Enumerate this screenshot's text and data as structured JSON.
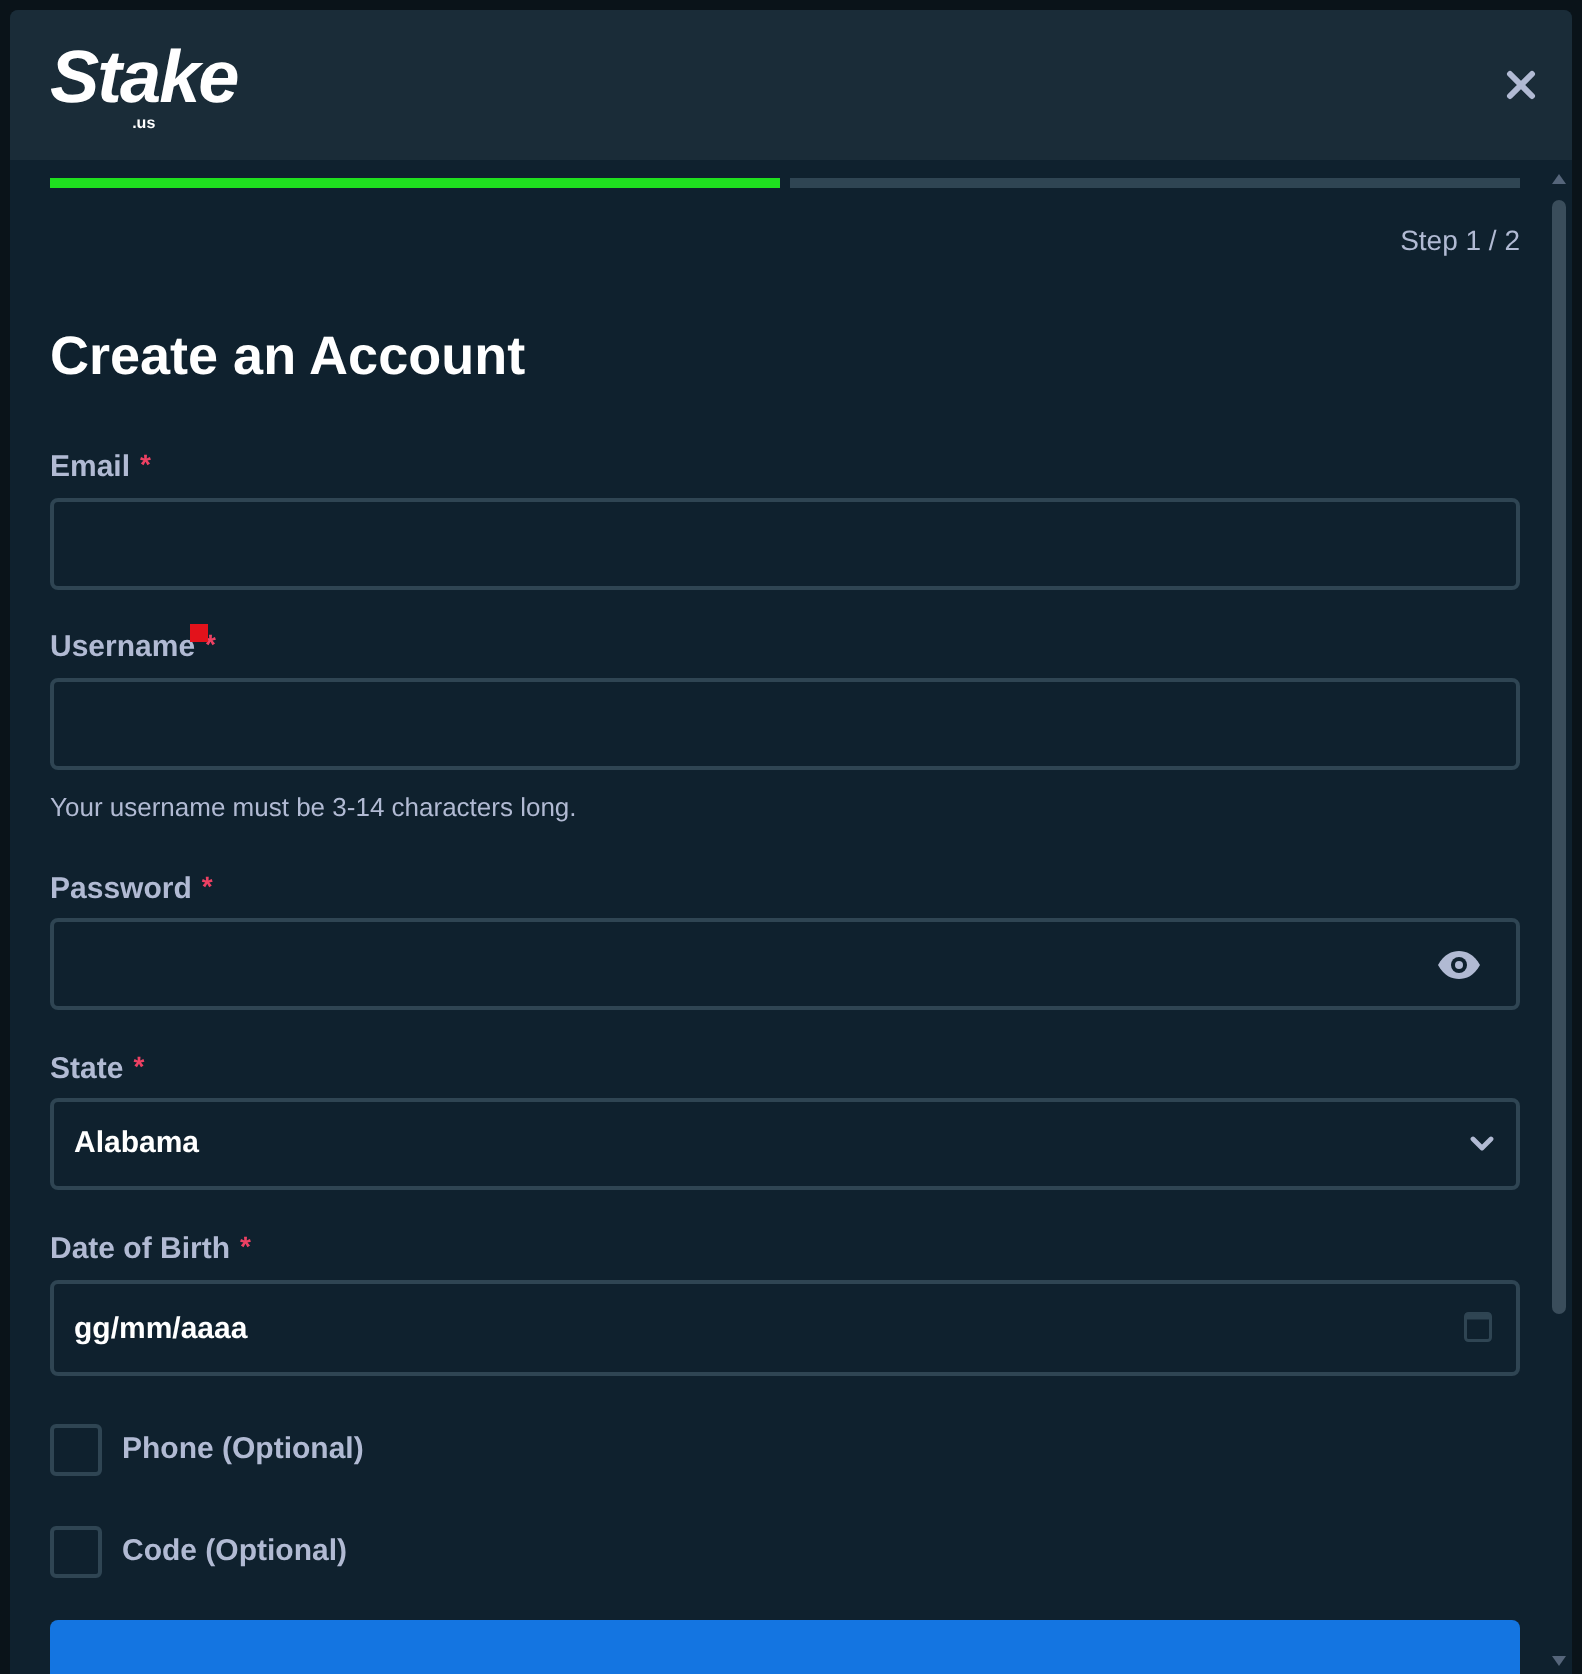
{
  "header": {
    "logo": {
      "wordmark": "Stake",
      "suffix": ".us"
    }
  },
  "progress": {
    "segments": [
      {
        "completed": true
      },
      {
        "completed": false
      }
    ],
    "step_label": "Step 1 / 2"
  },
  "title": "Create an Account",
  "fields": [
    {
      "kind": "email",
      "label": "Email",
      "required_mark": "*"
    },
    {
      "kind": "text",
      "label": "Username",
      "required_mark": "*",
      "marked": true,
      "hint": "Your username must be 3-14 characters long."
    },
    {
      "kind": "password",
      "label": "Password",
      "required_mark": "*"
    },
    {
      "kind": "select",
      "label": "State",
      "required_mark": "*",
      "value": "Alabama"
    },
    {
      "kind": "date",
      "label": "Date of Birth",
      "required_mark": "*",
      "placeholder": "gg/mm/aaaa"
    }
  ],
  "options": [
    {
      "label": "Phone (Optional)",
      "checked": false
    },
    {
      "label": "Code (Optional)",
      "checked": false
    }
  ]
}
